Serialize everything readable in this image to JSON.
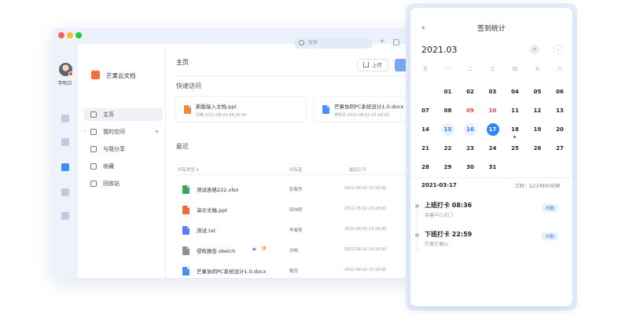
{
  "window": {
    "search_placeholder": "搜索",
    "user_name": "李明白",
    "app_title": "芒果云文档"
  },
  "sidebar": {
    "items": [
      {
        "label": "主页",
        "icon": "home-icon"
      },
      {
        "label": "我的空间",
        "icon": "folder-icon"
      },
      {
        "label": "与我分享",
        "icon": "share-icon"
      },
      {
        "label": "收藏",
        "icon": "star-icon"
      },
      {
        "label": "回收站",
        "icon": "trash-icon"
      }
    ]
  },
  "main": {
    "title": "主页",
    "upload_label": "上传",
    "quick_title": "快速访问",
    "quick": [
      {
        "name": "新版接入文档.ppt",
        "meta": "刘畅   2022-08-09 08:30:55",
        "color": "#f08a3c"
      },
      {
        "name": "芒果协同PC系统设计1.0.docx",
        "meta": "李明白   2022-08-02 15:18:00",
        "color": "#4c8df6"
      }
    ],
    "recent_title": "最近",
    "col_type": "所有类型 ▾",
    "col_owner": "所有者",
    "col_time": "最后打开",
    "files": [
      {
        "name": "测试表格222.xlsx",
        "owner": "彭敬然",
        "date": "2022-08-02 15:18:00",
        "color": "#3ca45c"
      },
      {
        "name": "演示文稿.ppt",
        "owner": "田伟刚",
        "date": "2022-08-02 15:18:00",
        "color": "#f06a3a"
      },
      {
        "name": "测试.txt",
        "owner": "李春燕",
        "date": "2022-08-02 15:18:00",
        "color": "#5b7cf0"
      },
      {
        "name": "侵权报告.sketch",
        "owner": "刘畅",
        "date": "2022-08-02 15:18:00",
        "color": "#8a8f99"
      },
      {
        "name": "芒果协同PC系统设计1.0.docx",
        "owner": "戴雨",
        "date": "2022-08-02 15:18:00",
        "color": "#4c8df6"
      }
    ]
  },
  "calendar": {
    "title": "签到统计",
    "month": "2021.03",
    "weekdays": [
      "日",
      "一",
      "二",
      "三",
      "四",
      "五",
      "六"
    ],
    "weeks": [
      [
        "",
        "01",
        "02",
        "03",
        "04",
        "05",
        "06"
      ],
      [
        "07",
        "08",
        "09",
        "10",
        "11",
        "12",
        "13"
      ],
      [
        "14",
        "15",
        "16",
        "17",
        "18",
        "19",
        "20"
      ],
      [
        "21",
        "22",
        "23",
        "24",
        "25",
        "26",
        "27"
      ],
      [
        "28",
        "29",
        "30",
        "31",
        "",
        "",
        ""
      ]
    ],
    "red_days": [
      "09",
      "10"
    ],
    "highlight_days": [
      "15",
      "16"
    ],
    "selected_day": "17",
    "marked_day": "18",
    "selected_date": "2021-03-17",
    "work_time": "工时：12小时00分钟",
    "punches": [
      {
        "label": "上班打卡 08:36",
        "location": "会展中心北门",
        "badge": "内勤"
      },
      {
        "label": "下班打卡 22:59",
        "location": "芒果芒果tv",
        "badge": "内勤"
      }
    ]
  }
}
